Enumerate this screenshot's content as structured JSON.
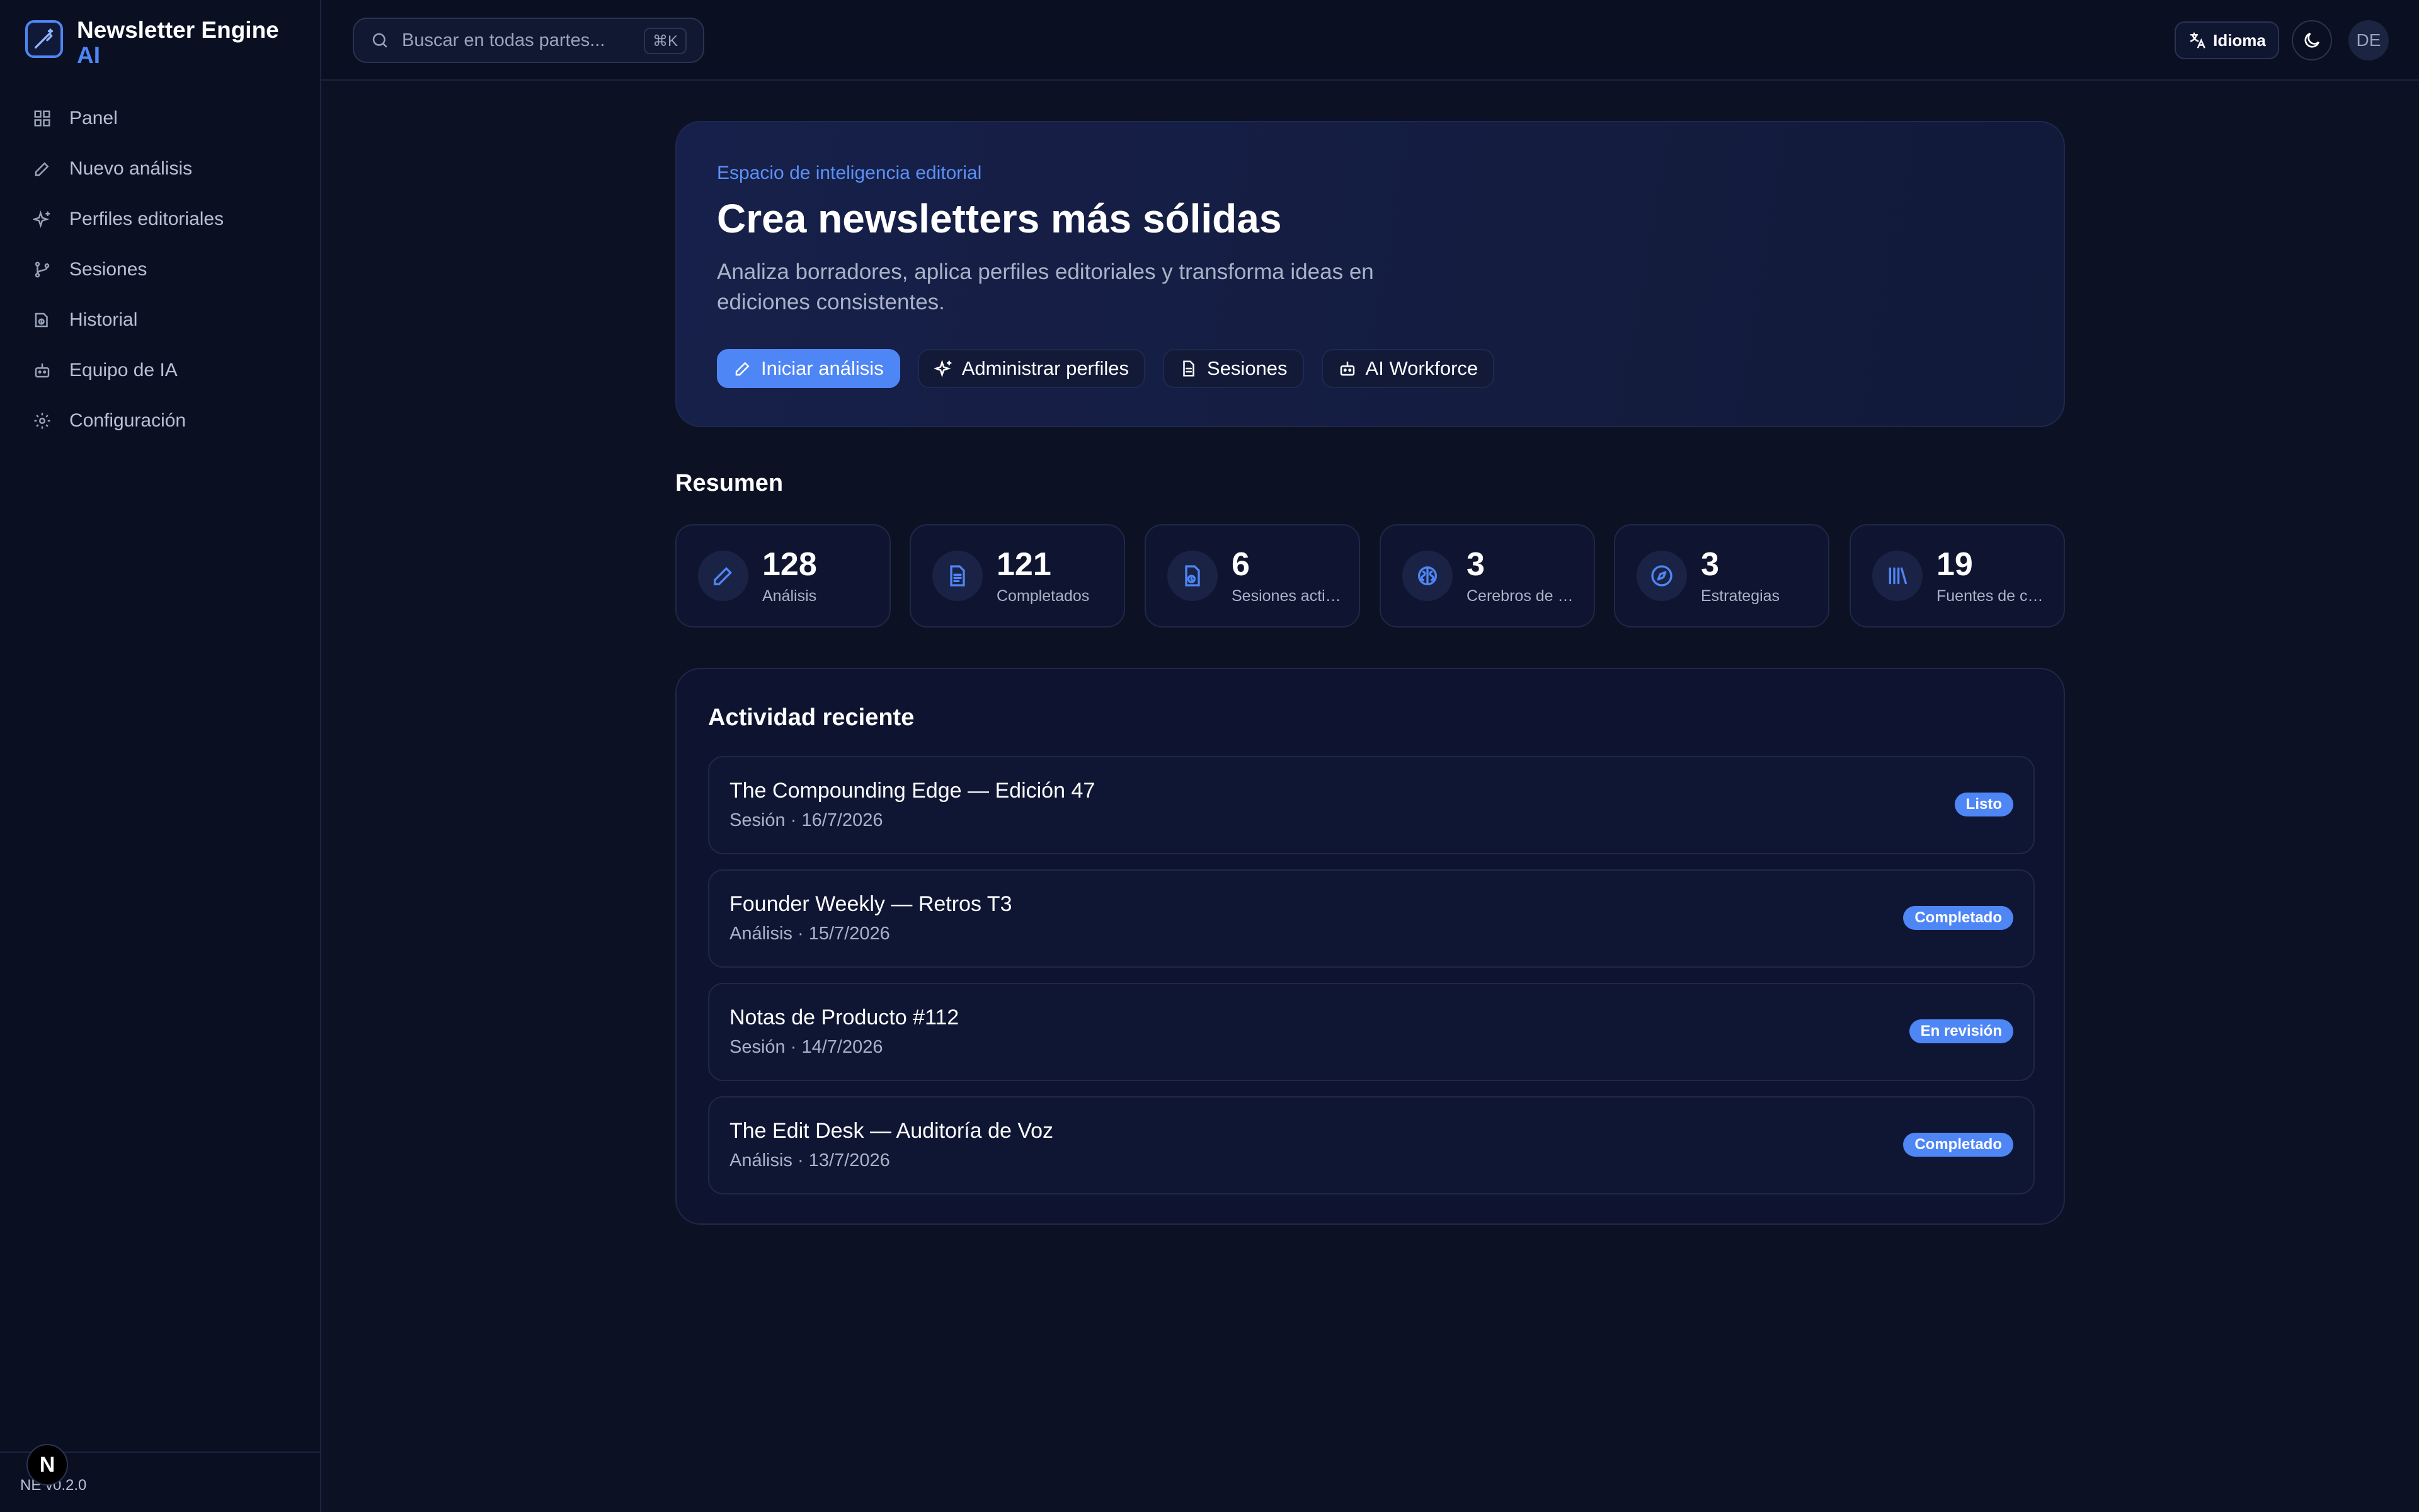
{
  "brand": {
    "name": "Newsletter Engine",
    "sub": "AI"
  },
  "sidebar": {
    "items": [
      {
        "label": "Panel",
        "icon": "grid-icon"
      },
      {
        "label": "Nuevo análisis",
        "icon": "pencil-icon"
      },
      {
        "label": "Perfiles editoriales",
        "icon": "sparkles-icon"
      },
      {
        "label": "Sesiones",
        "icon": "branch-icon"
      },
      {
        "label": "Historial",
        "icon": "history-icon"
      },
      {
        "label": "Equipo de IA",
        "icon": "bot-icon"
      },
      {
        "label": "Configuración",
        "icon": "gear-icon"
      }
    ],
    "footer_badge": "N",
    "version": "NE v0.2.0"
  },
  "topbar": {
    "search_placeholder": "Buscar en todas partes...",
    "shortcut": "⌘K",
    "language_label": "Idioma",
    "avatar_initials": "DE"
  },
  "hero": {
    "eyebrow": "Espacio de inteligencia editorial",
    "title": "Crea newsletters más sólidas",
    "description": "Analiza borradores, aplica perfiles editoriales y transforma ideas en ediciones consistentes.",
    "actions": [
      {
        "label": "Iniciar análisis"
      },
      {
        "label": "Administrar perfiles"
      },
      {
        "label": "Sesiones"
      },
      {
        "label": "AI Workforce"
      }
    ]
  },
  "summary": {
    "title": "Resumen",
    "stats": [
      {
        "value": "128",
        "label": "Análisis"
      },
      {
        "value": "121",
        "label": "Completados"
      },
      {
        "value": "6",
        "label": "Sesiones activas"
      },
      {
        "value": "3",
        "label": "Cerebros de marca"
      },
      {
        "value": "3",
        "label": "Estrategias"
      },
      {
        "value": "19",
        "label": "Fuentes de conocimiento"
      }
    ]
  },
  "activity": {
    "title": "Actividad reciente",
    "items": [
      {
        "title": "The Compounding Edge — Edición 47",
        "meta": "Sesión · 16/7/2026",
        "status": "Listo"
      },
      {
        "title": "Founder Weekly — Retros T3",
        "meta": "Análisis · 15/7/2026",
        "status": "Completado"
      },
      {
        "title": "Notas de Producto #112",
        "meta": "Sesión · 14/7/2026",
        "status": "En revisión"
      },
      {
        "title": "The Edit Desk — Auditoría de Voz",
        "meta": "Análisis · 13/7/2026",
        "status": "Completado"
      }
    ]
  },
  "colors": {
    "accent": "#4f86f5",
    "background": "#0c1224",
    "surface": "#0f1530"
  }
}
